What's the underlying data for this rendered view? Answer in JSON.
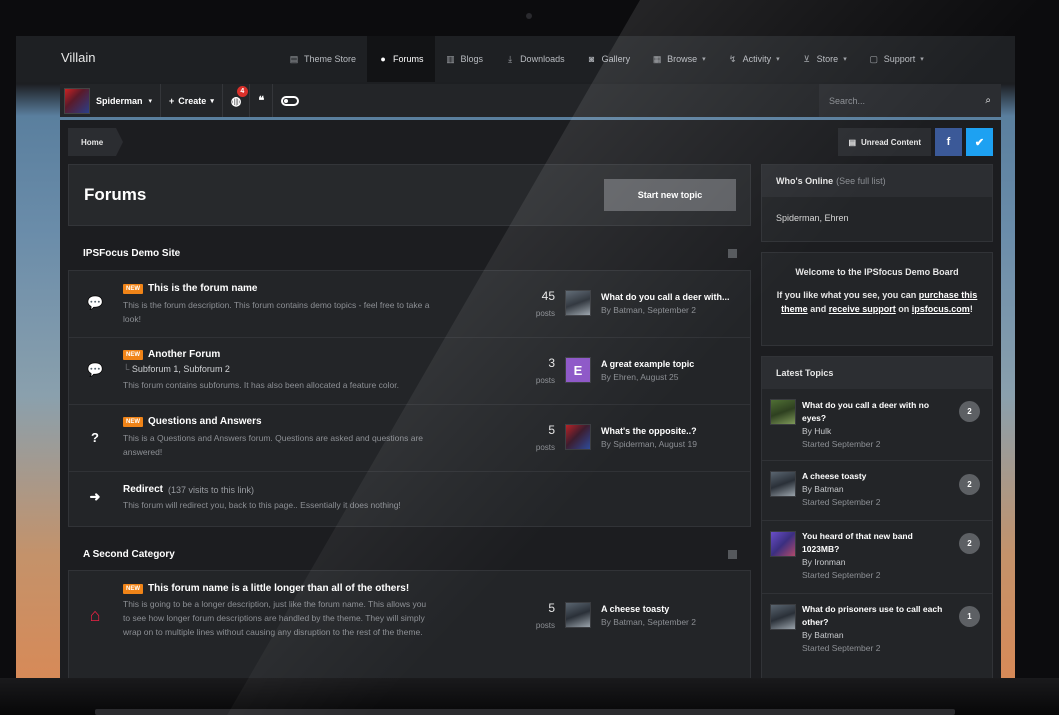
{
  "site": {
    "brand": "Villain"
  },
  "nav": [
    {
      "label": "Theme Store",
      "icon": "document-icon",
      "active": false,
      "caret": false
    },
    {
      "label": "Forums",
      "icon": "chat-icon",
      "active": true,
      "caret": false
    },
    {
      "label": "Blogs",
      "icon": "book-icon",
      "active": false,
      "caret": false
    },
    {
      "label": "Downloads",
      "icon": "download-icon",
      "active": false,
      "caret": false
    },
    {
      "label": "Gallery",
      "icon": "camera-icon",
      "active": false,
      "caret": false
    },
    {
      "label": "Browse",
      "icon": "grid-icon",
      "active": false,
      "caret": true
    },
    {
      "label": "Activity",
      "icon": "activity-icon",
      "active": false,
      "caret": true
    },
    {
      "label": "Store",
      "icon": "cart-icon",
      "active": false,
      "caret": true
    },
    {
      "label": "Support",
      "icon": "support-icon",
      "active": false,
      "caret": true
    }
  ],
  "userbar": {
    "username": "Spiderman",
    "create_label": "Create",
    "notification_count": "4",
    "search_placeholder": "Search..."
  },
  "breadcrumb": {
    "home": "Home",
    "unread": "Unread Content",
    "facebook": "f",
    "twitter": "t"
  },
  "main": {
    "title": "Forums",
    "start_topic": "Start new topic",
    "categories": [
      {
        "title": "IPSFocus Demo Site",
        "forums": [
          {
            "name": "This is the forum name",
            "new_badge": "NEW",
            "desc": "This is the forum description. This forum contains demo topics - feel free to take a look!",
            "posts": "45",
            "posts_label": "posts",
            "last_title": "What do you call a deer with...",
            "last_by": "By Batman, September 2"
          },
          {
            "name": "Another Forum",
            "new_badge": "NEW",
            "subforums": "Subforum 1,  Subforum 2",
            "desc": "This forum contains subforums. It has also been allocated a feature color.",
            "posts": "3",
            "posts_label": "posts",
            "last_title": "A great example topic",
            "last_by": "By Ehren, August 25",
            "avatar_letter": "E"
          },
          {
            "name": "Questions and Answers",
            "new_badge": "NEW",
            "desc": "This is a Questions and Answers forum. Questions are asked and questions are answered!",
            "posts": "5",
            "posts_label": "posts",
            "last_title": "What's the opposite..?",
            "last_by": "By Spiderman, August 19"
          },
          {
            "name": "Redirect",
            "redirect_note": "(137 visits to this link)",
            "desc": "This forum will redirect you, back to this page.. Essentially it does nothing!"
          }
        ]
      },
      {
        "title": "A Second Category",
        "forums": [
          {
            "name": "This forum name is a little longer than all of the others!",
            "new_badge": "NEW",
            "desc": "This is going to be a longer description, just like the forum name. This allows you to see how longer forum descriptions are handled by the theme. They will simply wrap on to multiple lines without causing any disruption to the rest of the theme.",
            "posts": "5",
            "posts_label": "posts",
            "last_title": "A cheese toasty",
            "last_by": "By Batman, September 2"
          }
        ]
      }
    ]
  },
  "sidebar": {
    "online": {
      "title": "Who's Online",
      "see_full": "(See full list)",
      "users": "Spiderman, Ehren"
    },
    "welcome": {
      "title": "Welcome to the IPSfocus Demo Board",
      "line_pre": "If you like what you see, you can",
      "link1": "purchase this theme",
      "and": "and",
      "link2": "receive support",
      "on": "on",
      "link3": "ipsfocus.com",
      "end": "!"
    },
    "latest": {
      "title": "Latest Topics",
      "topics": [
        {
          "title": "What do you call a deer with no eyes?",
          "by": "By Hulk",
          "started": "Started September 2",
          "count": "2"
        },
        {
          "title": "A cheese toasty",
          "by": "By Batman",
          "started": "Started September 2",
          "count": "2"
        },
        {
          "title": "You heard of that new band 1023MB?",
          "by": "By Ironman",
          "started": "Started September 2",
          "count": "2"
        },
        {
          "title": "What do prisoners use to call each other?",
          "by": "By Batman",
          "started": "Started September 2",
          "count": "1"
        }
      ]
    }
  }
}
